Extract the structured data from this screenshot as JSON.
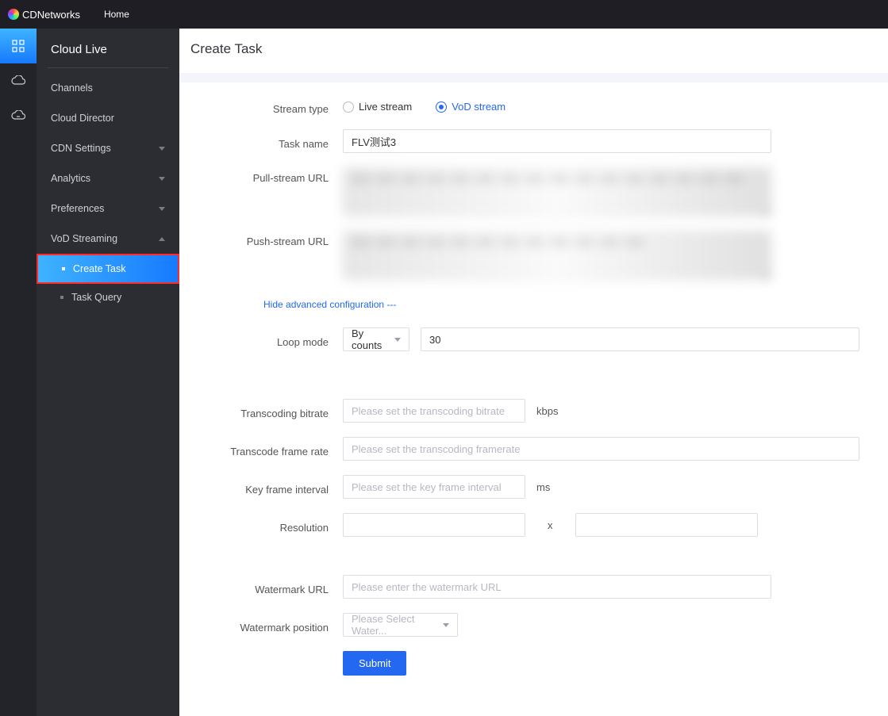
{
  "header": {
    "brand": "CDNetworks",
    "home": "Home"
  },
  "sidebar": {
    "title": "Cloud Live",
    "items": [
      {
        "label": "Channels"
      },
      {
        "label": "Cloud Director"
      },
      {
        "label": "CDN Settings"
      },
      {
        "label": "Analytics"
      },
      {
        "label": "Preferences"
      },
      {
        "label": "VoD Streaming"
      }
    ],
    "sub": {
      "createTask": "Create Task",
      "taskQuery": "Task Query"
    }
  },
  "page": {
    "title": "Create Task"
  },
  "form": {
    "streamType": {
      "label": "Stream type",
      "live": "Live stream",
      "vod": "VoD stream"
    },
    "taskName": {
      "label": "Task name",
      "value": "FLV测试3"
    },
    "pullUrl": {
      "label": "Pull-stream URL",
      "value": ""
    },
    "pushUrl": {
      "label": "Push-stream URL",
      "value": ""
    },
    "advancedToggle": "Hide advanced configuration ---",
    "loopMode": {
      "label": "Loop mode",
      "select": "By counts",
      "value": "30"
    },
    "transBitrate": {
      "label": "Transcoding bitrate",
      "placeholder": "Please set the transcoding bitrate",
      "unit": "kbps"
    },
    "transFramerate": {
      "label": "Transcode frame rate",
      "placeholder": "Please set the transcoding framerate"
    },
    "keyframe": {
      "label": "Key frame interval",
      "placeholder": "Please set the key frame interval",
      "unit": "ms"
    },
    "resolution": {
      "label": "Resolution",
      "sep": "x"
    },
    "watermarkUrl": {
      "label": "Watermark URL",
      "placeholder": "Please enter the watermark URL"
    },
    "watermarkPos": {
      "label": "Watermark position",
      "placeholder": "Please Select Water..."
    },
    "submit": "Submit"
  }
}
